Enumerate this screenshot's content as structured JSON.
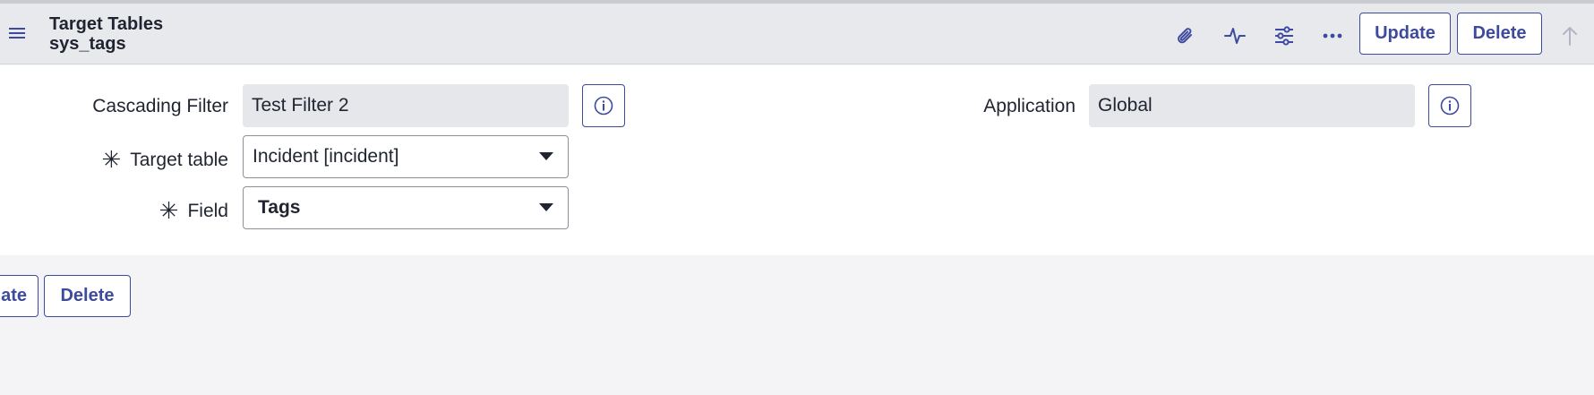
{
  "header": {
    "title": "Target Tables",
    "subtitle": "sys_tags",
    "icons": [
      "menu-icon",
      "paperclip-icon",
      "activity-icon",
      "sliders-icon",
      "more-icon",
      "arrow-up-icon"
    ],
    "update_label": "Update",
    "delete_label": "Delete"
  },
  "form": {
    "cascading_filter": {
      "label": "Cascading Filter",
      "value": "Test Filter 2"
    },
    "target_table": {
      "label": "Target table",
      "value": "Incident [incident]",
      "required_mark": "✳"
    },
    "field": {
      "label": "Field",
      "value": "Tags",
      "required_mark": "✳"
    },
    "application": {
      "label": "Application",
      "value": "Global"
    }
  },
  "footer": {
    "update_label": "ate",
    "delete_label": "Delete"
  },
  "colors": {
    "accent": "#3d4a9e",
    "header_bg": "#e8e9ed",
    "readonly_bg": "#e6e7ea"
  }
}
